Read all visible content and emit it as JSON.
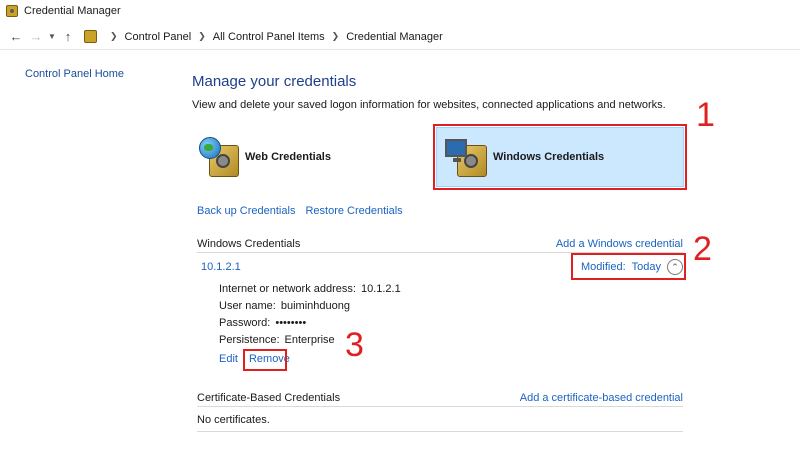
{
  "window": {
    "title": "Credential Manager"
  },
  "address": {
    "crumbs": [
      "Control Panel",
      "All Control Panel Items",
      "Credential Manager"
    ],
    "icons": [
      "back-arrow",
      "forward-arrow",
      "recent-chevron",
      "up-arrow",
      "folder-icon"
    ]
  },
  "sidebar": {
    "home_link": "Control Panel Home"
  },
  "main": {
    "heading": "Manage your credentials",
    "description": "View and delete your saved logon information for websites, connected applications and networks.",
    "tiles": {
      "web": {
        "label": "Web Credentials",
        "icon": "web-safe-globe"
      },
      "windows": {
        "label": "Windows Credentials",
        "icon": "windows-safe-monitor"
      }
    },
    "backup_label": "Back up Credentials",
    "restore_label": "Restore Credentials"
  },
  "windows_section": {
    "title": "Windows Credentials",
    "add_link": "Add a Windows credential",
    "entry": {
      "name": "10.1.2.1",
      "modified_label": "Modified:",
      "modified_value": "Today",
      "address_label": "Internet or network address:",
      "address_value": "10.1.2.1",
      "user_label": "User name:",
      "user_value": "buiminhduong",
      "password_label": "Password:",
      "password_value": "••••••••",
      "persistence_label": "Persistence:",
      "persistence_value": "Enterprise",
      "edit_label": "Edit",
      "remove_label": "Remove"
    }
  },
  "cert_section": {
    "title": "Certificate-Based Credentials",
    "add_link": "Add a certificate-based credential",
    "empty_text": "No certificates."
  },
  "annotations": {
    "one": "1",
    "two": "2",
    "three": "3",
    "color": "#e02020"
  },
  "colors": {
    "link": "#1a63c2",
    "heading": "#1e3f8a",
    "selected_tile": "#cce8ff"
  }
}
